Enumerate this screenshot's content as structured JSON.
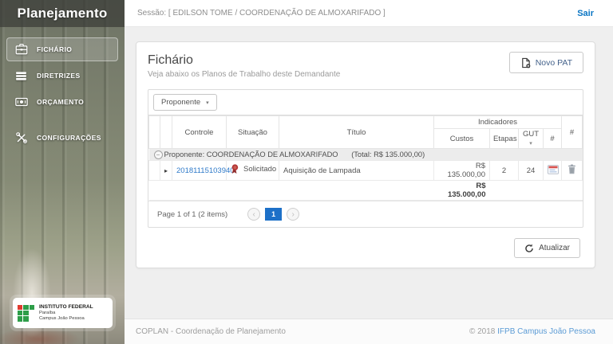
{
  "sidebar": {
    "title": "Planejamento",
    "items": [
      {
        "label": "FICHÁRIO",
        "icon": "briefcase-icon",
        "active": true
      },
      {
        "label": "DIRETRIZES",
        "icon": "list-icon",
        "active": false
      },
      {
        "label": "ORÇAMENTO",
        "icon": "money-icon",
        "active": false
      },
      {
        "label": "CONFIGURAÇÕES",
        "icon": "tools-icon",
        "active": false
      }
    ],
    "logo": {
      "line1": "INSTITUTO FEDERAL",
      "line2": "Paraíba",
      "line3": "Campus João Pessoa"
    }
  },
  "topbar": {
    "session": "Sessão: [ EDILSON TOME / COORDENAÇÃO DE ALMOXARIFADO ]",
    "logout": "Sair"
  },
  "card": {
    "title": "Fichário",
    "subtitle": "Veja abaixo os Planos de Trabalho deste Demandante",
    "new_button": "Novo PAT",
    "group_chip": "Proponente",
    "table": {
      "headers": {
        "controle": "Controle",
        "situacao": "Situação",
        "titulo": "Título",
        "indicadores": "Indicadores",
        "custos": "Custos",
        "etapas": "Etapas",
        "gut": "GUT",
        "hash": "#",
        "actions": "#"
      },
      "group_row": {
        "label": "Proponente: COORDENAÇÃO DE ALMOXARIFADO",
        "total": "(Total: R$ 135.000,00)"
      },
      "rows": [
        {
          "controle": "20181115103940",
          "situacao": "Solicitado",
          "titulo": "Aquisição de Lampada",
          "custos": "R$ 135.000,00",
          "etapas": "2",
          "gut": "24"
        }
      ],
      "summary": {
        "custos": "R$ 135.000,00"
      }
    },
    "pager": {
      "text": "Page 1 of 1 (2 items)",
      "page": "1"
    },
    "refresh_button": "Atualizar"
  },
  "footer": {
    "left": "COPLAN - Coordenação de Planejamento",
    "year": "© 2018",
    "link": "IFPB Campus João Pessoa"
  },
  "glyphs": {
    "caret": "▾",
    "expand": "▸",
    "collapse": "−",
    "prev": "‹",
    "next": "›"
  },
  "colors": {
    "pager_active": "#1d70c8",
    "link_blue": "#2f7ac9",
    "logout_blue": "#0b76c4",
    "footer_link_blue": "#5b9bd5",
    "status_red": "#b23535",
    "ifpb_green": "#2e9e49",
    "ifpb_red": "#e03a2f"
  }
}
